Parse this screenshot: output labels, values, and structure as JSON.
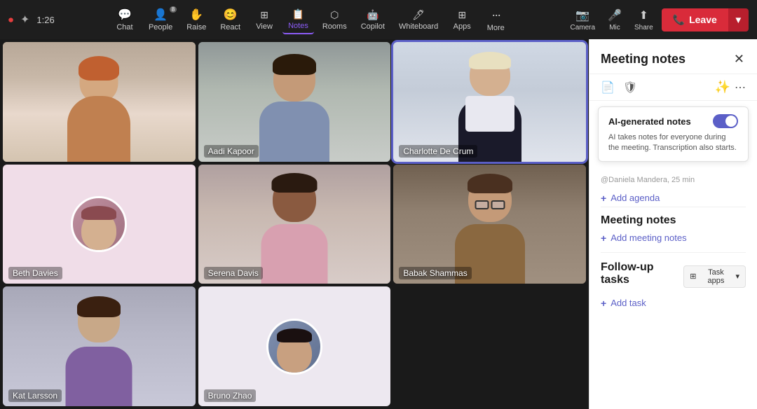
{
  "topbar": {
    "timer": "1:26",
    "nav_items": [
      {
        "id": "chat",
        "label": "Chat",
        "icon": "💬",
        "badge": null
      },
      {
        "id": "people",
        "label": "People",
        "icon": "👤",
        "badge": "8"
      },
      {
        "id": "raise",
        "label": "Raise",
        "icon": "✋",
        "badge": null
      },
      {
        "id": "react",
        "label": "React",
        "icon": "😊",
        "badge": null
      },
      {
        "id": "view",
        "label": "View",
        "icon": "⊞",
        "badge": null
      },
      {
        "id": "notes",
        "label": "Notes",
        "icon": "📋",
        "badge": null,
        "active": true
      },
      {
        "id": "rooms",
        "label": "Rooms",
        "icon": "⊟",
        "badge": null
      },
      {
        "id": "copilot",
        "label": "Copilot",
        "icon": "⬡",
        "badge": null
      },
      {
        "id": "whiteboard",
        "label": "Whiteboard",
        "icon": "◻",
        "badge": null
      },
      {
        "id": "apps",
        "label": "Apps",
        "icon": "+",
        "badge": null
      },
      {
        "id": "more",
        "label": "More",
        "icon": "•••",
        "badge": null
      },
      {
        "id": "camera",
        "label": "Camera",
        "icon": "📷",
        "badge": null
      },
      {
        "id": "mic",
        "label": "Mic",
        "icon": "🎤",
        "badge": null
      },
      {
        "id": "share",
        "label": "Share",
        "icon": "↑",
        "badge": null
      }
    ],
    "leave_label": "Leave"
  },
  "participants": [
    {
      "id": "p1",
      "name": "",
      "bg": "#c8b5a0",
      "row": 0,
      "col": 0,
      "active": false,
      "avatar_only": false
    },
    {
      "id": "p2",
      "name": "Aadi Kapoor",
      "bg": "#9a8878",
      "row": 0,
      "col": 1,
      "active": false,
      "avatar_only": false
    },
    {
      "id": "p3",
      "name": "Charlotte De Crum",
      "bg": "#d0d5dc",
      "row": 0,
      "col": 2,
      "active": true,
      "avatar_only": false
    },
    {
      "id": "p4",
      "name": "Beth Davies",
      "bg": "#f0dde8",
      "row": 1,
      "col": 0,
      "active": false,
      "avatar_only": true
    },
    {
      "id": "p5",
      "name": "Serena Davis",
      "bg": "#b8928a",
      "row": 1,
      "col": 1,
      "active": false,
      "avatar_only": false
    },
    {
      "id": "p6",
      "name": "Babak Shammas",
      "bg": "#8a7060",
      "row": 1,
      "col": 2,
      "active": false,
      "avatar_only": false
    },
    {
      "id": "p7",
      "name": "Kat Larsson",
      "bg": "#9090a0",
      "row": 2,
      "col": 0,
      "active": false,
      "avatar_only": false
    },
    {
      "id": "p8",
      "name": "Bruno Zhao",
      "bg": "#e8dde8",
      "row": 2,
      "col": 1,
      "active": false,
      "avatar_only": true
    }
  ],
  "side_panel": {
    "title": "Meeting notes",
    "ai_toggle": {
      "label": "AI-generated notes",
      "description": "AI takes notes for everyone during the meeting. Transcription also starts.",
      "enabled": true
    },
    "scrolled_hint": "@Daniela Mandera, 25 min",
    "agenda_section": {
      "title": "Meeting notes",
      "add_label": "Add meeting notes"
    },
    "followup_section": {
      "title": "Follow-up tasks",
      "task_apps_label": "Task apps",
      "add_task_label": "Add task"
    },
    "add_agenda_label": "Add agenda"
  }
}
